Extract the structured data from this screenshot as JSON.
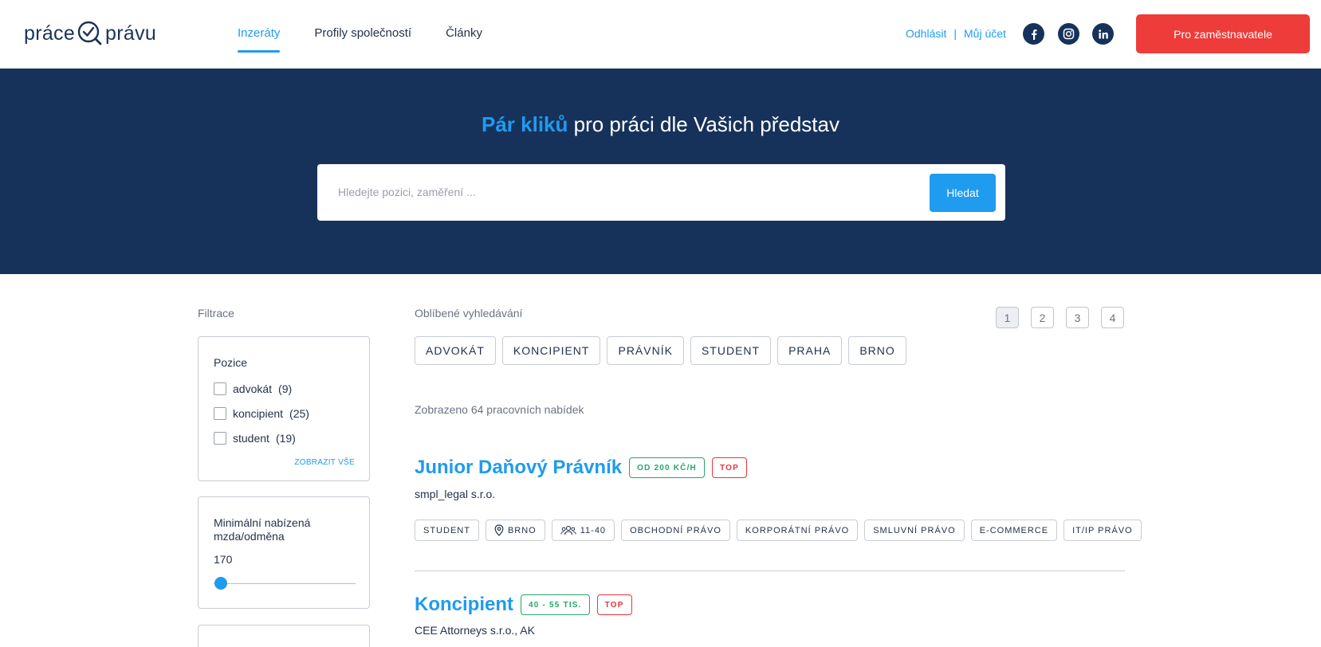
{
  "logo": {
    "part1": "práce",
    "part2": "právu"
  },
  "nav": [
    {
      "label": "Inzeráty",
      "active": true
    },
    {
      "label": "Profily společností",
      "active": false
    },
    {
      "label": "Články",
      "active": false
    }
  ],
  "account": {
    "logout": "Odhlásit",
    "separator": "|",
    "my_account": "Můj účet"
  },
  "social": [
    {
      "icon": "facebook-icon"
    },
    {
      "icon": "instagram-icon"
    },
    {
      "icon": "linkedin-icon"
    }
  ],
  "header_cta": "Pro zaměstnavatele",
  "hero": {
    "title_accent": "Pár kliků",
    "title_rest": " pro práci dle Vašich představ",
    "search_placeholder": "Hledejte pozici, zaměření ...",
    "search_button": "Hledat"
  },
  "sidebar": {
    "title": "Filtrace",
    "position_filter": {
      "title": "Pozice",
      "options": [
        {
          "label": "advokát",
          "count": "(9)"
        },
        {
          "label": "koncipient",
          "count": "(25)"
        },
        {
          "label": "student",
          "count": "(19)"
        }
      ],
      "show_all": "ZOBRAZIT VŠE"
    },
    "salary_filter": {
      "title": "Minimální nabízená mzda/odměna",
      "value": "170",
      "slider_level": 0.0
    }
  },
  "favorites": {
    "title": "Oblíbené vyhledávání",
    "tags": [
      "ADVOKÁT",
      "KONCIPIENT",
      "PRÁVNÍK",
      "STUDENT",
      "PRAHA",
      "BRNO"
    ]
  },
  "pagination": {
    "pages": [
      "1",
      "2",
      "3",
      "4"
    ],
    "current": "1"
  },
  "results_count": "Zobrazeno 64 pracovních nabídek",
  "jobs": [
    {
      "title": "Junior Daňový Právník",
      "salary": "OD 200 KČ/H",
      "badge": "TOP",
      "company": "smpl_legal s.r.o.",
      "tags": {
        "type": "STUDENT",
        "location": "BRNO",
        "size": "11-40",
        "areas": [
          "OBCHODNÍ PRÁVO",
          "KORPORÁTNÍ PRÁVO",
          "SMLUVNÍ PRÁVO",
          "E-COMMERCE",
          "IT/IP PRÁVO"
        ]
      }
    },
    {
      "title": "Koncipient",
      "salary": "40 - 55 TIS.",
      "badge": "TOP",
      "company": "CEE Attorneys s.r.o., AK"
    }
  ],
  "colors": {
    "navy": "#17325a",
    "accent": "#1f9bef",
    "cta": "#ee3c3a",
    "green": "#23a866"
  }
}
